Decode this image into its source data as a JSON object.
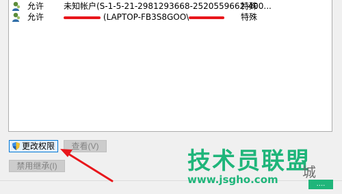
{
  "permission_list": {
    "rows": [
      {
        "type": "允许",
        "principal": "未知帐户(S-1-5-21-2981293668-2520559662-400...",
        "access": "特殊"
      },
      {
        "type": "允许",
        "principal_suffix": " (LAPTOP-FB3S8GOO\\",
        "access": "特殊"
      }
    ]
  },
  "buttons": {
    "change_permissions": "更改权限",
    "view": "查看(V)",
    "disable_inheritance": "禁用继承(I)"
  },
  "watermark": {
    "brand": "技术员联盟",
    "site": "www.jsgho.com",
    "city": "城",
    "tag": "...."
  },
  "colors": {
    "annotation_red": "#e8161b",
    "watermark_green": "#1fb57a"
  }
}
